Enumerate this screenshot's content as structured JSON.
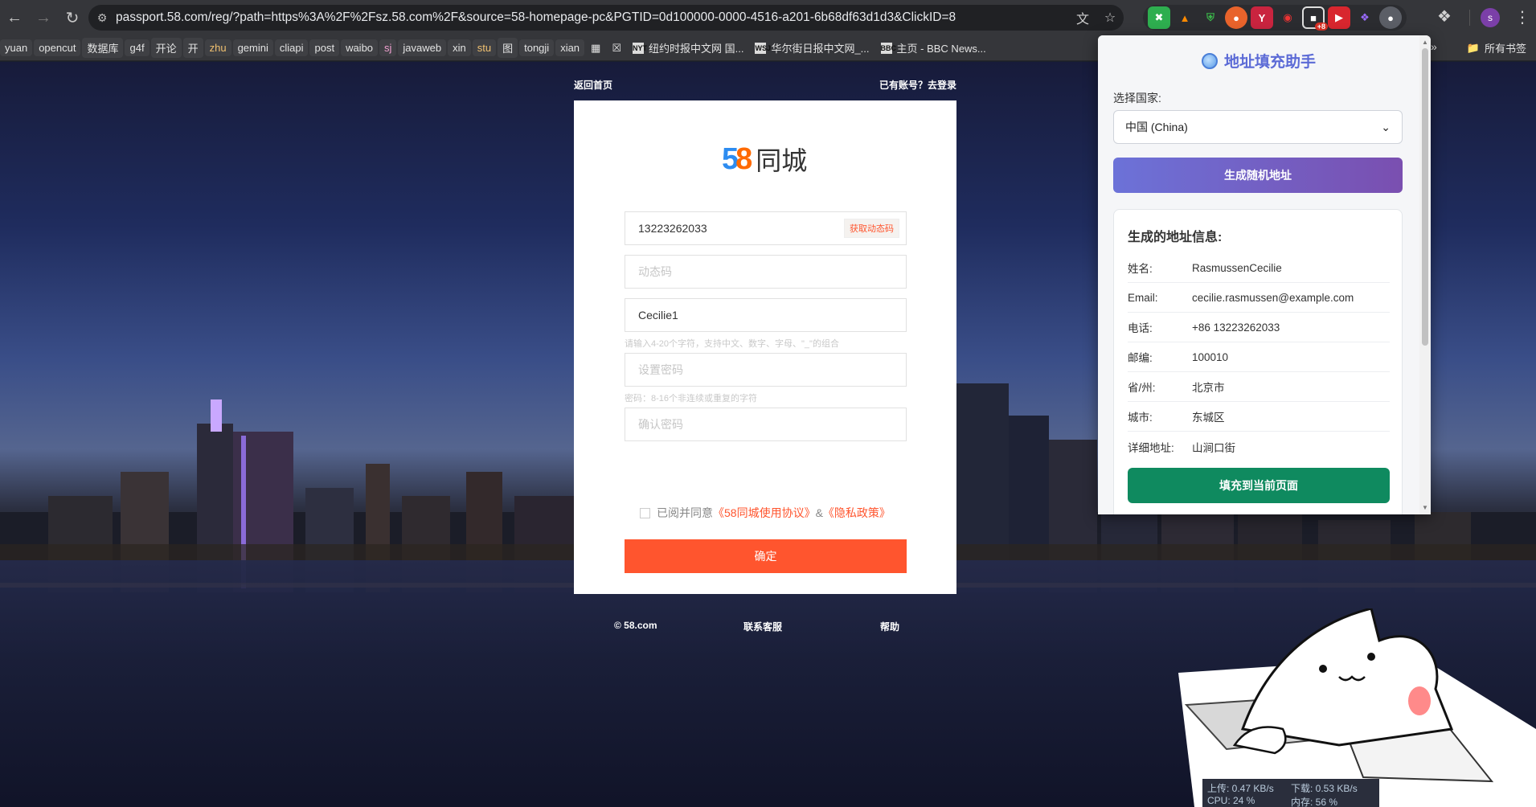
{
  "browser": {
    "url": "passport.58.com/reg/?path=https%3A%2F%2Fsz.58.com%2F&source=58-homepage-pc&PGTID=0d100000-0000-4516-a201-6b68df63d1d3&ClickID=8",
    "badge_count": "+8",
    "profile_initial": "s"
  },
  "bookmarks": {
    "items": [
      "yuan",
      "opencut",
      "数据库",
      "g4f",
      "开论",
      "开",
      "zhu",
      "gemini",
      "cliapi",
      "post",
      "waibo",
      "sj",
      "javaweb",
      "xin",
      "stu",
      "图",
      "tongji",
      "xian"
    ],
    "news": [
      {
        "icon": "NYT",
        "label": "纽约时报中文网 国..."
      },
      {
        "icon": "WSJ",
        "label": "华尔街日报中文网_..."
      },
      {
        "icon": "BBC",
        "label": "主页 - BBC News..."
      }
    ],
    "all_bookmarks": "所有书签"
  },
  "page": {
    "back_home": "返回首页",
    "login_link": "已有账号？去登录",
    "logo_text": "同城",
    "phone_value": "13223262033",
    "get_code": "获取动态码",
    "code_placeholder": "动态码",
    "username_value": "Cecilie1",
    "username_hint": "请输入4-20个字符，支持中文、数字、字母、\"_\"的组合",
    "password_placeholder": "设置密码",
    "password_hint": "密码：8-16个非连续或重复的字符",
    "confirm_placeholder": "确认密码",
    "agree_prefix": "已阅并同意",
    "agree_terms": "《58同城使用协议》",
    "agree_and": "&",
    "agree_privacy": "《隐私政策》",
    "submit": "确定",
    "footer_copyright": "© 58.com",
    "footer_service": "联系客服",
    "footer_help": "帮助"
  },
  "popup": {
    "title": "地址填充助手",
    "country_label": "选择国家:",
    "country_value": "中国 (China)",
    "generate_button": "生成随机地址",
    "result_heading": "生成的地址信息:",
    "rows": [
      {
        "key": "姓名:",
        "value": "RasmussenCecilie"
      },
      {
        "key": "Email:",
        "value": "cecilie.rasmussen@example.com"
      },
      {
        "key": "电话:",
        "value": "+86 13223262033"
      },
      {
        "key": "邮编:",
        "value": "100010"
      },
      {
        "key": "省/州:",
        "value": "北京市"
      },
      {
        "key": "城市:",
        "value": "东城区"
      },
      {
        "key": "详细地址:",
        "value": "山涧口街"
      }
    ],
    "fill_button": "填充到当前页面"
  },
  "netstat": {
    "upload": "上传: 0.47 KB/s",
    "download": "下载: 0.53 KB/s",
    "cpu": "CPU: 24 %",
    "memory": "内存: 56 %"
  }
}
